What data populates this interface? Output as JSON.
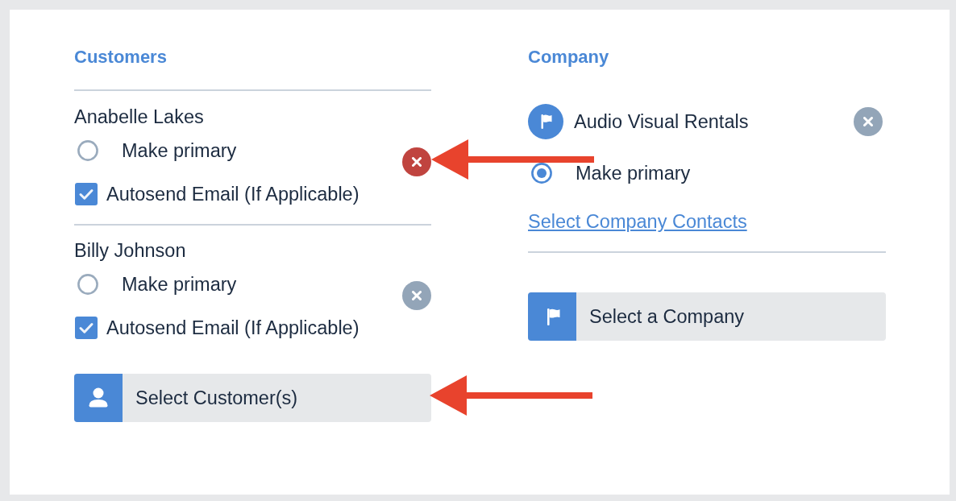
{
  "customers_panel": {
    "heading": "Customers",
    "customers": [
      {
        "name": "Anabelle Lakes",
        "primary_label": "Make primary",
        "primary": false,
        "autosend_label": "Autosend Email (If Applicable)",
        "autosend": true,
        "remove_highlighted": true,
        "callout_arrow": true
      },
      {
        "name": "Billy Johnson",
        "primary_label": "Make primary",
        "primary": false,
        "autosend_label": "Autosend Email (If Applicable)",
        "autosend": true,
        "remove_highlighted": false,
        "callout_arrow": false
      }
    ],
    "select_button": {
      "label": "Select Customer(s)",
      "callout_arrow": true
    }
  },
  "company_panel": {
    "heading": "Company",
    "company": {
      "name": "Audio Visual Rentals",
      "primary_label": "Make primary",
      "primary": true,
      "remove_highlighted": false
    },
    "contacts_link": "Select Company Contacts",
    "select_button": {
      "label": "Select a Company"
    }
  }
}
